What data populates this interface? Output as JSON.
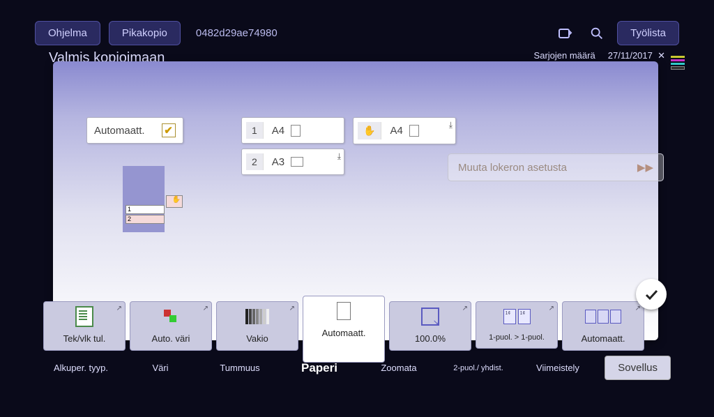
{
  "topbar": {
    "program": "Ohjelma",
    "quickcopy": "Pikakopio",
    "serial": "0482d29ae74980",
    "joblist": "Työlista"
  },
  "status": {
    "ready": "Valmis kopioimaan",
    "count_label": "Sarjojen määrä",
    "date": "27/11/2017"
  },
  "modal": {
    "auto": "Automaatt.",
    "tray1_size": "A4",
    "tray2_size": "A3",
    "bypass_size": "A4",
    "change_tray": "Muuta lokeron asetusta"
  },
  "diagram": {
    "slot1": "1",
    "slot2": "2"
  },
  "tiles": {
    "original": "Tek/vlk tul.",
    "color": "Auto. väri",
    "density": "Vakio",
    "paper": "Automaatt.",
    "zoom": "100.0%",
    "duplex": "1-puol. > 1-puol.",
    "finish": "Automaatt."
  },
  "cats": {
    "original": "Alkuper. tyyp.",
    "color": "Väri",
    "density": "Tummuus",
    "paper": "Paperi",
    "zoom": "Zoomata",
    "duplex": "2-puol./ yhdist.",
    "finish": "Viimeistely"
  },
  "app_btn": "Sovellus"
}
